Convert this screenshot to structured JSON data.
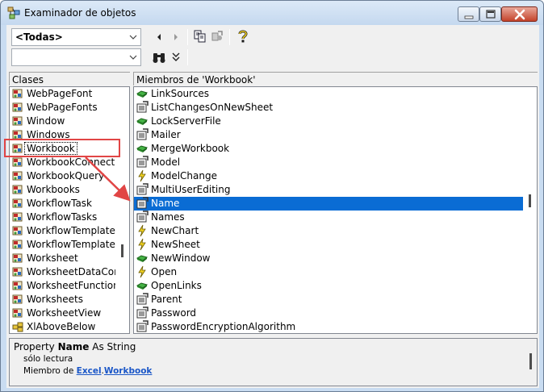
{
  "window": {
    "title": "Examinador de objetos"
  },
  "toolbar": {
    "library_combo_value": "<Todas>",
    "search_combo_value": ""
  },
  "classes": {
    "header": "Clases",
    "items": [
      {
        "label": "WebPageFont",
        "icon": "class-icon"
      },
      {
        "label": "WebPageFonts",
        "icon": "class-icon"
      },
      {
        "label": "Window",
        "icon": "class-icon"
      },
      {
        "label": "Windows",
        "icon": "class-icon"
      },
      {
        "label": "Workbook",
        "icon": "class-icon"
      },
      {
        "label": "WorkbookConnectio",
        "icon": "class-icon"
      },
      {
        "label": "WorkbookQuery",
        "icon": "class-icon"
      },
      {
        "label": "Workbooks",
        "icon": "class-icon"
      },
      {
        "label": "WorkflowTask",
        "icon": "class-icon"
      },
      {
        "label": "WorkflowTasks",
        "icon": "class-icon"
      },
      {
        "label": "WorkflowTemplate",
        "icon": "class-icon"
      },
      {
        "label": "WorkflowTemplates",
        "icon": "class-icon"
      },
      {
        "label": "Worksheet",
        "icon": "class-icon"
      },
      {
        "label": "WorksheetDataConr",
        "icon": "class-icon"
      },
      {
        "label": "WorksheetFunction",
        "icon": "class-icon"
      },
      {
        "label": "Worksheets",
        "icon": "class-icon"
      },
      {
        "label": "WorksheetView",
        "icon": "class-icon"
      },
      {
        "label": "XlAboveBelow",
        "icon": "enum-icon"
      }
    ]
  },
  "members": {
    "header": "Miembros de 'Workbook'",
    "items": [
      {
        "label": "LinkSources",
        "icon": "method-icon"
      },
      {
        "label": "ListChangesOnNewSheet",
        "icon": "property-icon"
      },
      {
        "label": "LockServerFile",
        "icon": "method-icon"
      },
      {
        "label": "Mailer",
        "icon": "property-icon"
      },
      {
        "label": "MergeWorkbook",
        "icon": "method-icon"
      },
      {
        "label": "Model",
        "icon": "property-icon"
      },
      {
        "label": "ModelChange",
        "icon": "event-icon"
      },
      {
        "label": "MultiUserEditing",
        "icon": "property-icon"
      },
      {
        "label": "Name",
        "icon": "property-icon"
      },
      {
        "label": "Names",
        "icon": "property-icon"
      },
      {
        "label": "NewChart",
        "icon": "event-icon"
      },
      {
        "label": "NewSheet",
        "icon": "event-icon"
      },
      {
        "label": "NewWindow",
        "icon": "method-icon"
      },
      {
        "label": "Open",
        "icon": "event-icon"
      },
      {
        "label": "OpenLinks",
        "icon": "method-icon"
      },
      {
        "label": "Parent",
        "icon": "property-icon"
      },
      {
        "label": "Password",
        "icon": "property-icon"
      },
      {
        "label": "PasswordEncryptionAlgorithm",
        "icon": "property-icon"
      }
    ]
  },
  "details": {
    "prefix": "Property",
    "member_name": "Name",
    "type_text": "As String",
    "readonly_text": "sólo lectura",
    "member_of_text": "Miembro de",
    "library_link": "Excel",
    "dot": ".",
    "class_link": "Workbook"
  },
  "colors": {
    "selection": "#0a6cd4",
    "annotation": "#e14545",
    "link": "#1a56c7"
  }
}
